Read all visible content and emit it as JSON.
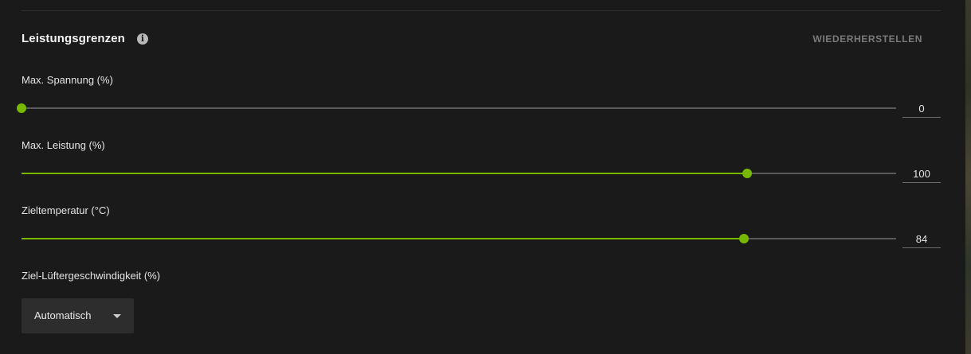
{
  "section": {
    "title": "Leistungsgrenzen",
    "info_icon": "info-icon",
    "reset_label": "WIEDERHERSTELLEN"
  },
  "sliders": [
    {
      "label": "Max. Spannung (%)",
      "value": "0",
      "fraction": 0.0
    },
    {
      "label": "Max. Leistung (%)",
      "value": "100",
      "fraction": 0.83
    },
    {
      "label": "Zieltemperatur (°C)",
      "value": "84",
      "fraction": 0.826
    }
  ],
  "fan": {
    "label": "Ziel-Lüftergeschwindigkeit (%)",
    "selected": "Automatisch",
    "icon": "chevron-down-icon"
  },
  "colors": {
    "accent": "#76b900",
    "background": "#1a1a1a"
  }
}
